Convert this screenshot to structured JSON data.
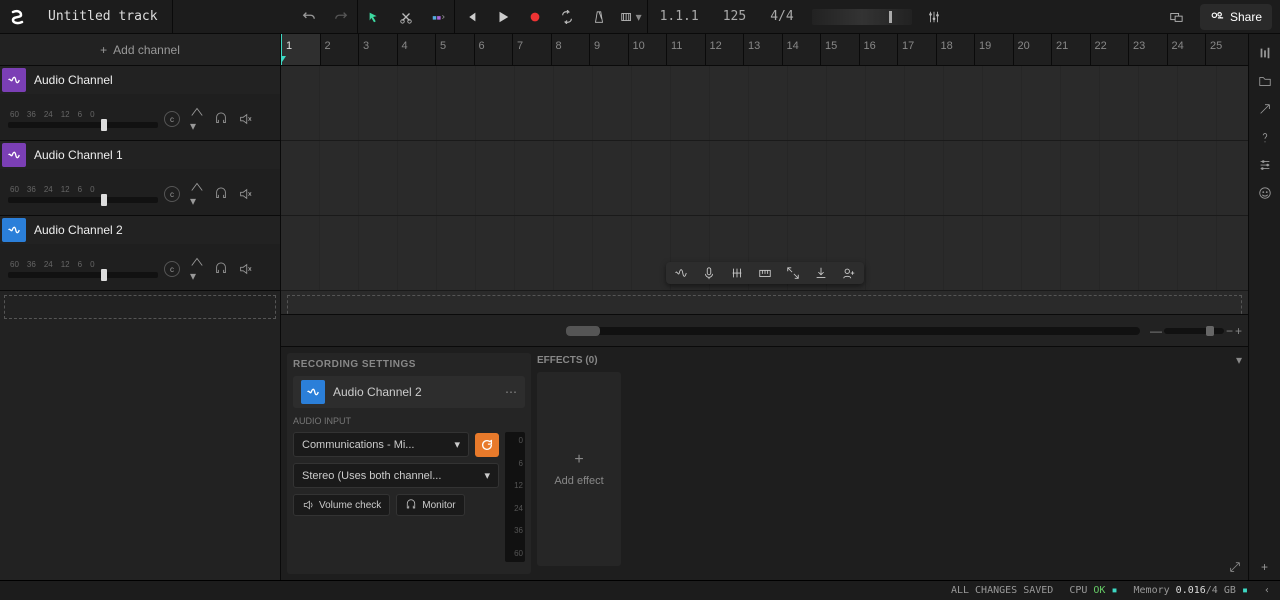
{
  "title": "Untitled track",
  "transport": {
    "position": "1.1.1",
    "tempo": "125",
    "time_sig": "4/4"
  },
  "share_label": "Share",
  "add_channel_label": "Add channel",
  "channels": [
    {
      "name": "Audio Channel",
      "icon_color": "purple"
    },
    {
      "name": "Audio Channel 1",
      "icon_color": "purple"
    },
    {
      "name": "Audio Channel 2",
      "icon_color": "blue"
    }
  ],
  "db_marks": [
    "60",
    "36",
    "24",
    "12",
    "6",
    "0"
  ],
  "bars": [
    "1",
    "2",
    "3",
    "4",
    "5",
    "6",
    "7",
    "8",
    "9",
    "10",
    "11",
    "12",
    "13",
    "14",
    "15",
    "16",
    "17",
    "18",
    "19",
    "20",
    "21",
    "22",
    "23",
    "24",
    "25"
  ],
  "recording_settings": {
    "title": "RECORDING SETTINGS",
    "channel": "Audio Channel 2",
    "audio_input_label": "AUDIO INPUT",
    "input_device": "Communications - Mi...",
    "input_mode": "Stereo (Uses both channel...",
    "volume_check": "Volume check",
    "monitor": "Monitor",
    "vu_marks": [
      "0",
      "6",
      "12",
      "24",
      "36",
      "60"
    ]
  },
  "effects": {
    "title": "EFFECTS (0)",
    "add_label": "Add effect"
  },
  "status": {
    "saved": "ALL CHANGES SAVED",
    "cpu_label": "CPU",
    "cpu_value": "OK",
    "mem_label": "Memory",
    "mem_value": "0.016",
    "mem_total": "/4",
    "mem_unit": "GB"
  }
}
